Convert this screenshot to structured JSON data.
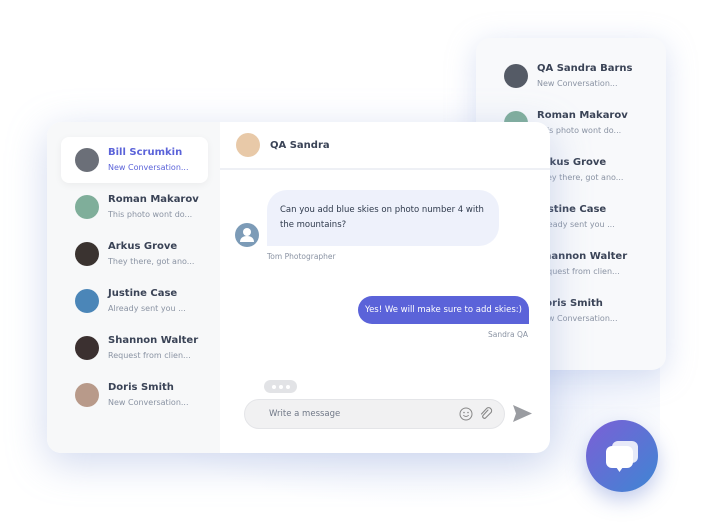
{
  "back_list": [
    {
      "name": "QA Sandra Barns",
      "preview": "New Conversation..."
    },
    {
      "name": "Roman Makarov",
      "preview": "This photo wont do..."
    },
    {
      "name": "Arkus Grove",
      "preview": "They there, got ano..."
    },
    {
      "name": "Justine Case",
      "preview": "Already sent you ..."
    },
    {
      "name": "Shannon Walter",
      "preview": "Request from clien..."
    },
    {
      "name": "Doris Smith",
      "preview": "New Conversation..."
    }
  ],
  "sidebar": [
    {
      "name": "Bill Scrumkin",
      "preview": "New Conversation...",
      "color": "#6b6f78"
    },
    {
      "name": "Roman Makarov",
      "preview": "This photo wont do...",
      "color": "#7fae9a"
    },
    {
      "name": "Arkus Grove",
      "preview": "They there, got ano...",
      "color": "#3a3330"
    },
    {
      "name": "Justine Case",
      "preview": "Already sent you ...",
      "color": "#4b86b8"
    },
    {
      "name": "Shannon Walter",
      "preview": "Request from clien...",
      "color": "#3b3030"
    },
    {
      "name": "Doris Smith",
      "preview": "New Conversation...",
      "color": "#b89a8a"
    }
  ],
  "chat": {
    "title": "QA Sandra",
    "messages": [
      {
        "text": "Can you add blue skies on photo number 4 with the mountains?",
        "sender": "Tom Photographer"
      },
      {
        "text": "Yes! We will make sure to add skies:)",
        "sender": "Sandra QA"
      }
    ],
    "input_placeholder": "Write a message"
  },
  "colors": {
    "accent": "#5b63d9"
  }
}
